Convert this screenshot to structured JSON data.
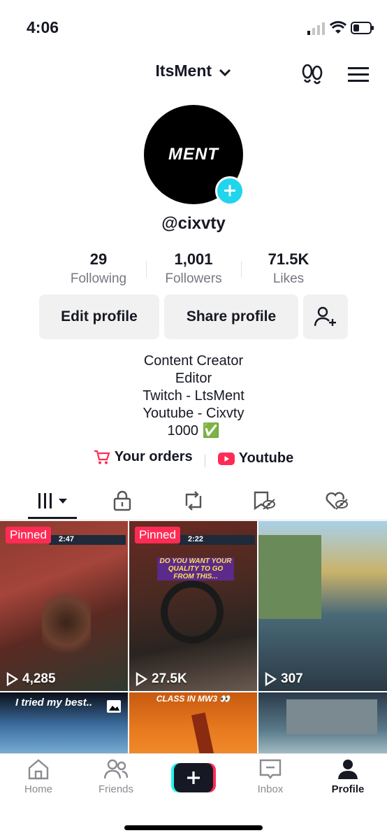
{
  "status": {
    "time": "4:06"
  },
  "header": {
    "username": "ItsMent"
  },
  "profile": {
    "avatar_text": "MENT",
    "handle": "@cixvty",
    "stats": [
      {
        "value": "29",
        "label": "Following"
      },
      {
        "value": "1,001",
        "label": "Followers"
      },
      {
        "value": "71.5K",
        "label": "Likes"
      }
    ],
    "buttons": {
      "edit": "Edit profile",
      "share": "Share profile"
    },
    "bio": [
      "Content Creator",
      "Editor",
      "Twitch - LtsMent",
      "Youtube - Cixvty",
      "1000 ✅"
    ],
    "links": {
      "orders": "Your orders",
      "youtube": "Youtube"
    }
  },
  "videos": [
    {
      "pinned": "Pinned",
      "views": "4,285",
      "hud": "2:47"
    },
    {
      "pinned": "Pinned",
      "views": "27.5K",
      "hud": "2:22",
      "caption": "DO YOU WANT YOUR QUALITY TO GO FROM THIS..."
    },
    {
      "views": "307"
    },
    {
      "caption": "I tried my best.."
    },
    {
      "caption": "CLASS IN MW3 👀"
    },
    {}
  ],
  "nav": {
    "home": "Home",
    "friends": "Friends",
    "inbox": "Inbox",
    "profile": "Profile"
  },
  "colors": {
    "accent": "#fe2c55",
    "badge": "#20d5ec",
    "text": "#161823"
  }
}
